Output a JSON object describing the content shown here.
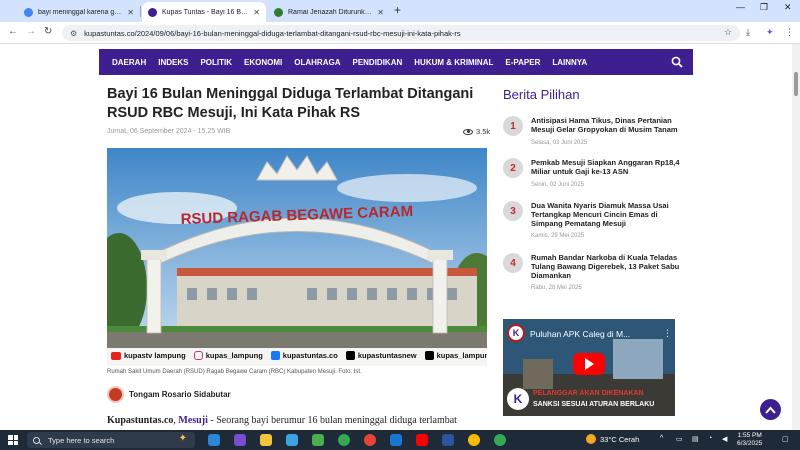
{
  "browser": {
    "tabs": [
      {
        "title": "bayi meninggal karena ga ada",
        "active": false,
        "favicon_color": "#4285f4"
      },
      {
        "title": "Kupas Tuntas - Bayi 16 Bulan M",
        "active": true,
        "favicon_color": "#3d1f8f"
      },
      {
        "title": "Ramai Jenazah Diturunkan karena",
        "active": false,
        "favicon_color": "#2e7d32"
      }
    ],
    "url": "kupastuntas.co/2024/09/06/bayi-16-bulan-meninggal-diduga-terlambat-ditangani-rsud-rbc-mesuji-ini-kata-pihak-rs"
  },
  "site": {
    "nav_items": [
      "DAERAH",
      "INDEKS",
      "POLITIK",
      "EKONOMI",
      "OLAHRAGA",
      "PENDIDIKAN",
      "HUKUM & KRIMINAL",
      "E-PAPER",
      "LAINNYA"
    ],
    "accent_color": "#3d1f8f"
  },
  "article": {
    "title": "Bayi 16 Bulan Meninggal Diduga Terlambat Ditangani RSUD RBC Mesuji, Ini Kata Pihak RS",
    "date": "Jumat, 06 September 2024 - 15.25 WIB",
    "views": "3.5k",
    "photo": {
      "sign_text": "RSUD RAGAB BEGAWE CARAM",
      "socials": [
        {
          "icon": "youtube-icon",
          "handle": "kupastv lampung",
          "color": "#e62117"
        },
        {
          "icon": "instagram-icon",
          "handle": "kupas_lampung",
          "color": "#c13584"
        },
        {
          "icon": "facebook-icon",
          "handle": "kupastuntas.co",
          "color": "#1877f2"
        },
        {
          "icon": "x-icon",
          "handle": "kupastuntasnew",
          "color": "#000000"
        },
        {
          "icon": "tiktok-icon",
          "handle": "kupas_lampung",
          "color": "#000000"
        }
      ]
    },
    "caption": "Rumah Sakit Umum Daerah (RSUD) Ragab Begawe Caram (RBC) Kabupaten Mesuji. Foto: Ist.",
    "author": "Tongam Rosario Sidabutar",
    "lede_source": "Kupastuntas.co",
    "lede_place": "Mesuji",
    "lede_text": " - Seorang bayi berumur 16 bulan meninggal diduga terlambat"
  },
  "sidebar": {
    "title": "Berita Pilihan",
    "items": [
      {
        "num": "1",
        "title": "Antisipasi Hama Tikus, Dinas Pertanian Mesuji Gelar Gropyokan di Musim Tanam",
        "date": "Selasa, 03 Juni 2025"
      },
      {
        "num": "2",
        "title": "Pemkab Mesuji Siapkan Anggaran Rp18,4 Miliar untuk Gaji ke-13 ASN",
        "date": "Senin, 02 Juni 2025"
      },
      {
        "num": "3",
        "title": "Dua Wanita Nyaris Diamuk Massa Usai Tertangkap Mencuri Cincin Emas di Simpang Pematang Mesuji",
        "date": "Kamis, 29 Mei 2025"
      },
      {
        "num": "4",
        "title": "Rumah Bandar Narkoba di Kuala Teladas Tulang Bawang Digerebek, 13 Paket Sabu Diamankan",
        "date": "Rabu, 28 Mei 2025"
      }
    ],
    "video": {
      "title": "Puluhan APK Caleg di M...",
      "overlay_line1": "PELANGGAR AKAN DIKENAKAN",
      "overlay_line2": "SANKSI SESUAI ATURAN BERLAKU"
    }
  },
  "taskbar": {
    "search_placeholder": "Type here to search",
    "weather": "33°C  Cerah",
    "time": "1:55 PM",
    "date": "6/3/2025"
  }
}
